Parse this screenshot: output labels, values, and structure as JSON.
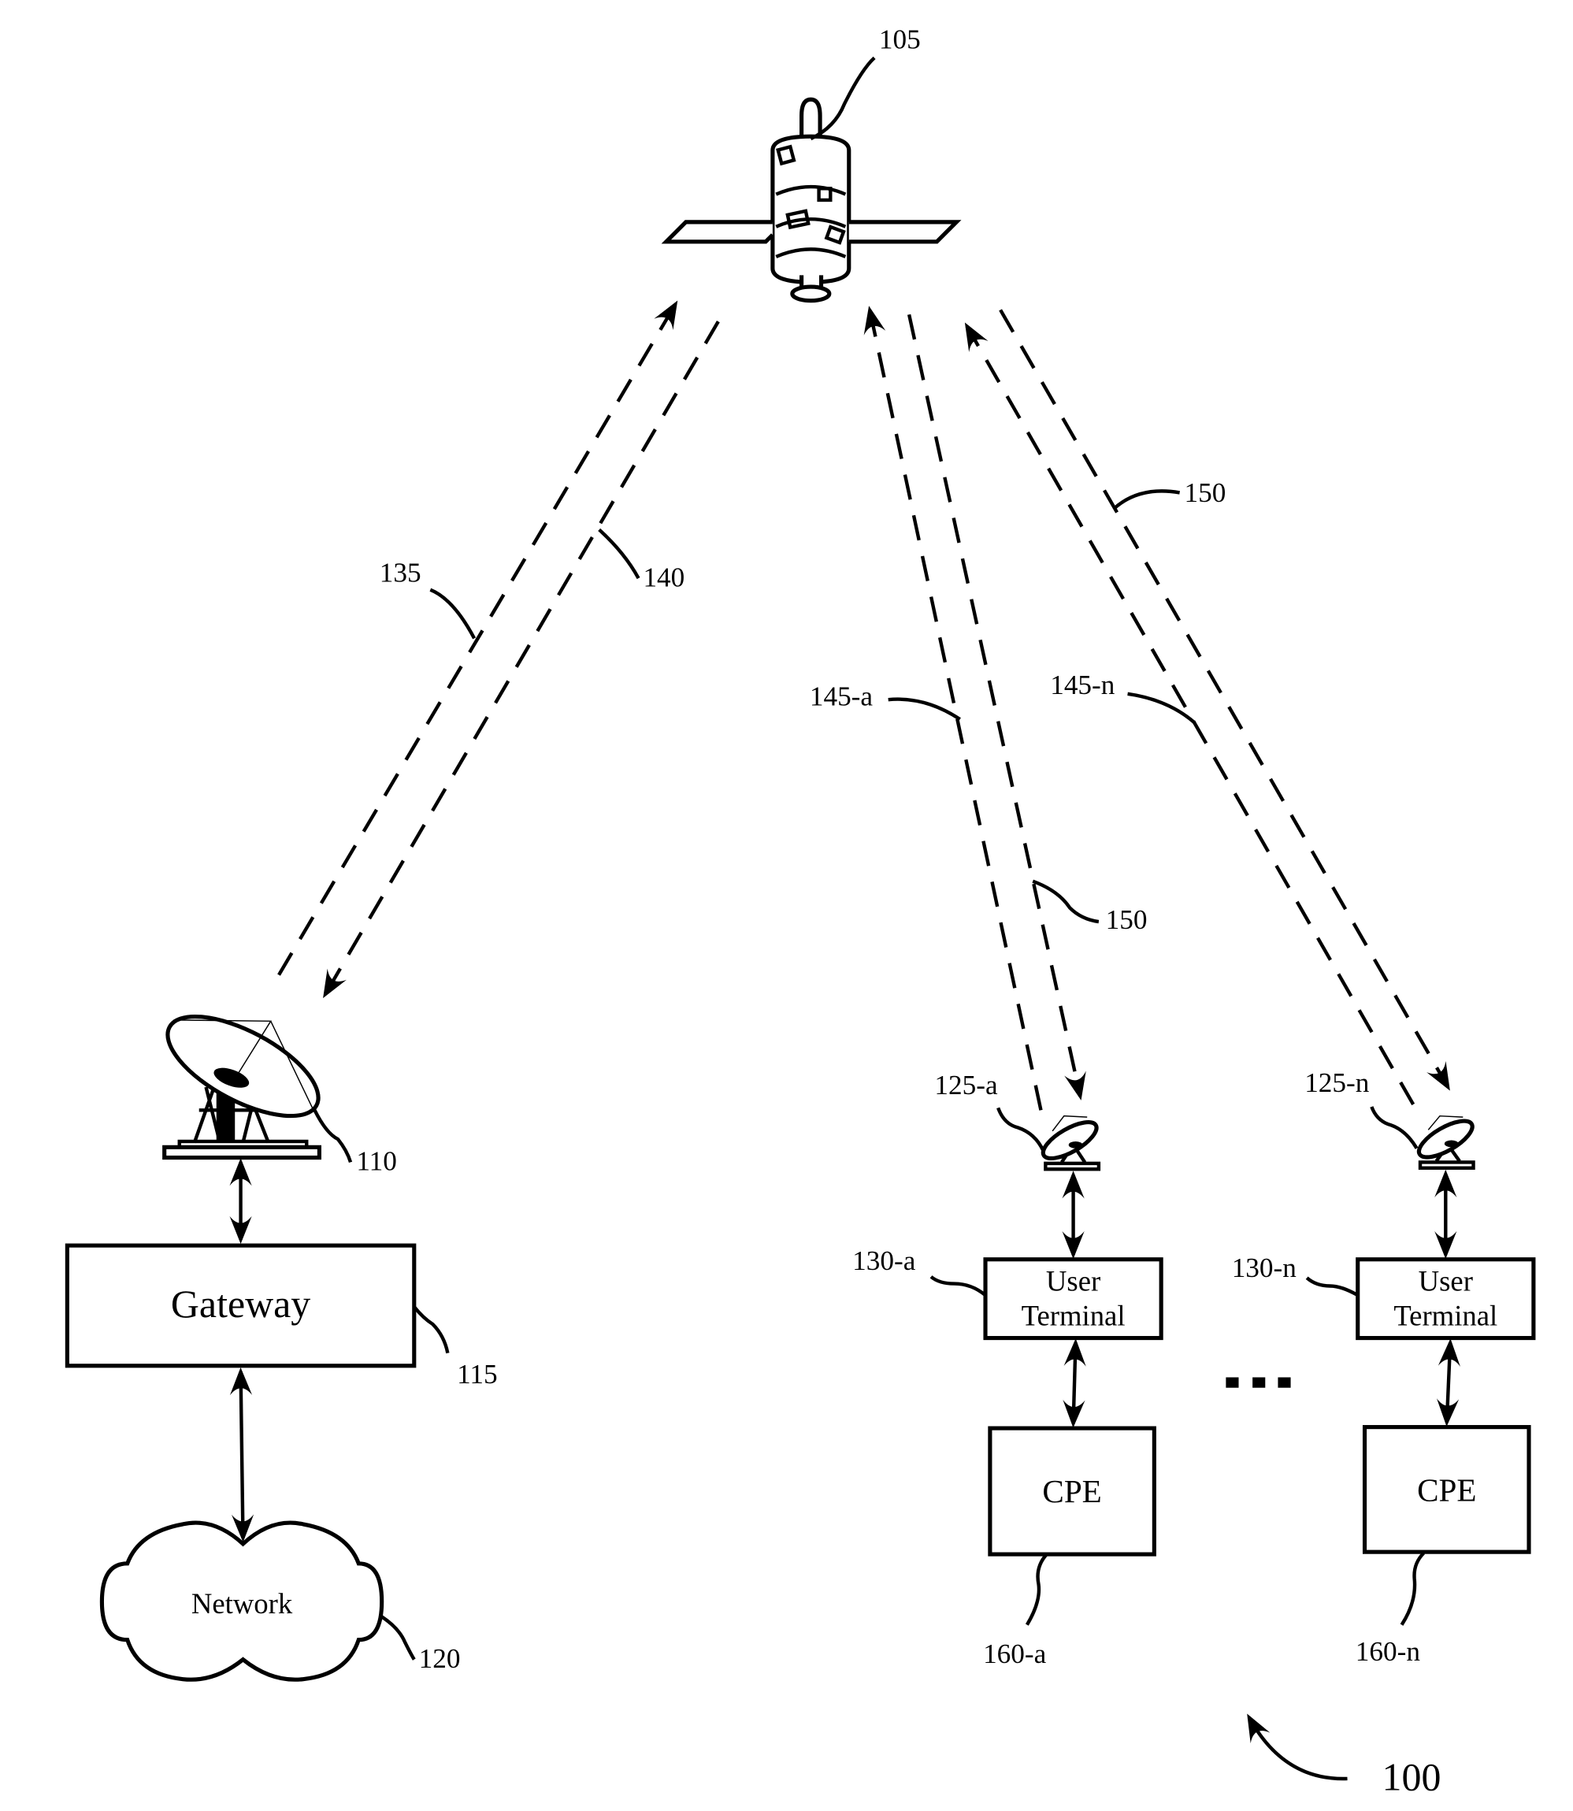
{
  "figure": {
    "figure_ref": "100",
    "satellite": {
      "ref": "105",
      "icon": "satellite-icon"
    },
    "gateway_antenna": {
      "ref": "110",
      "icon": "dish-antenna-icon"
    },
    "gateway": {
      "label": "Gateway",
      "ref": "115"
    },
    "network": {
      "label": "Network",
      "ref": "120"
    },
    "links": {
      "gateway_uplink": "135",
      "gateway_downlink": "140",
      "user_uplink_a": "145-a",
      "user_uplink_n": "145-n",
      "user_downlink_a": "150",
      "user_downlink_n": "150"
    },
    "terminals": [
      {
        "antenna_ref": "125-a",
        "terminal_ref": "130-a",
        "terminal_label_line1": "User",
        "terminal_label_line2": "Terminal",
        "cpe_label": "CPE",
        "cpe_ref": "160-a"
      },
      {
        "antenna_ref": "125-n",
        "terminal_ref": "130-n",
        "terminal_label_line1": "User",
        "terminal_label_line2": "Terminal",
        "cpe_label": "CPE",
        "cpe_ref": "160-n"
      }
    ],
    "ellipsis": "..."
  }
}
